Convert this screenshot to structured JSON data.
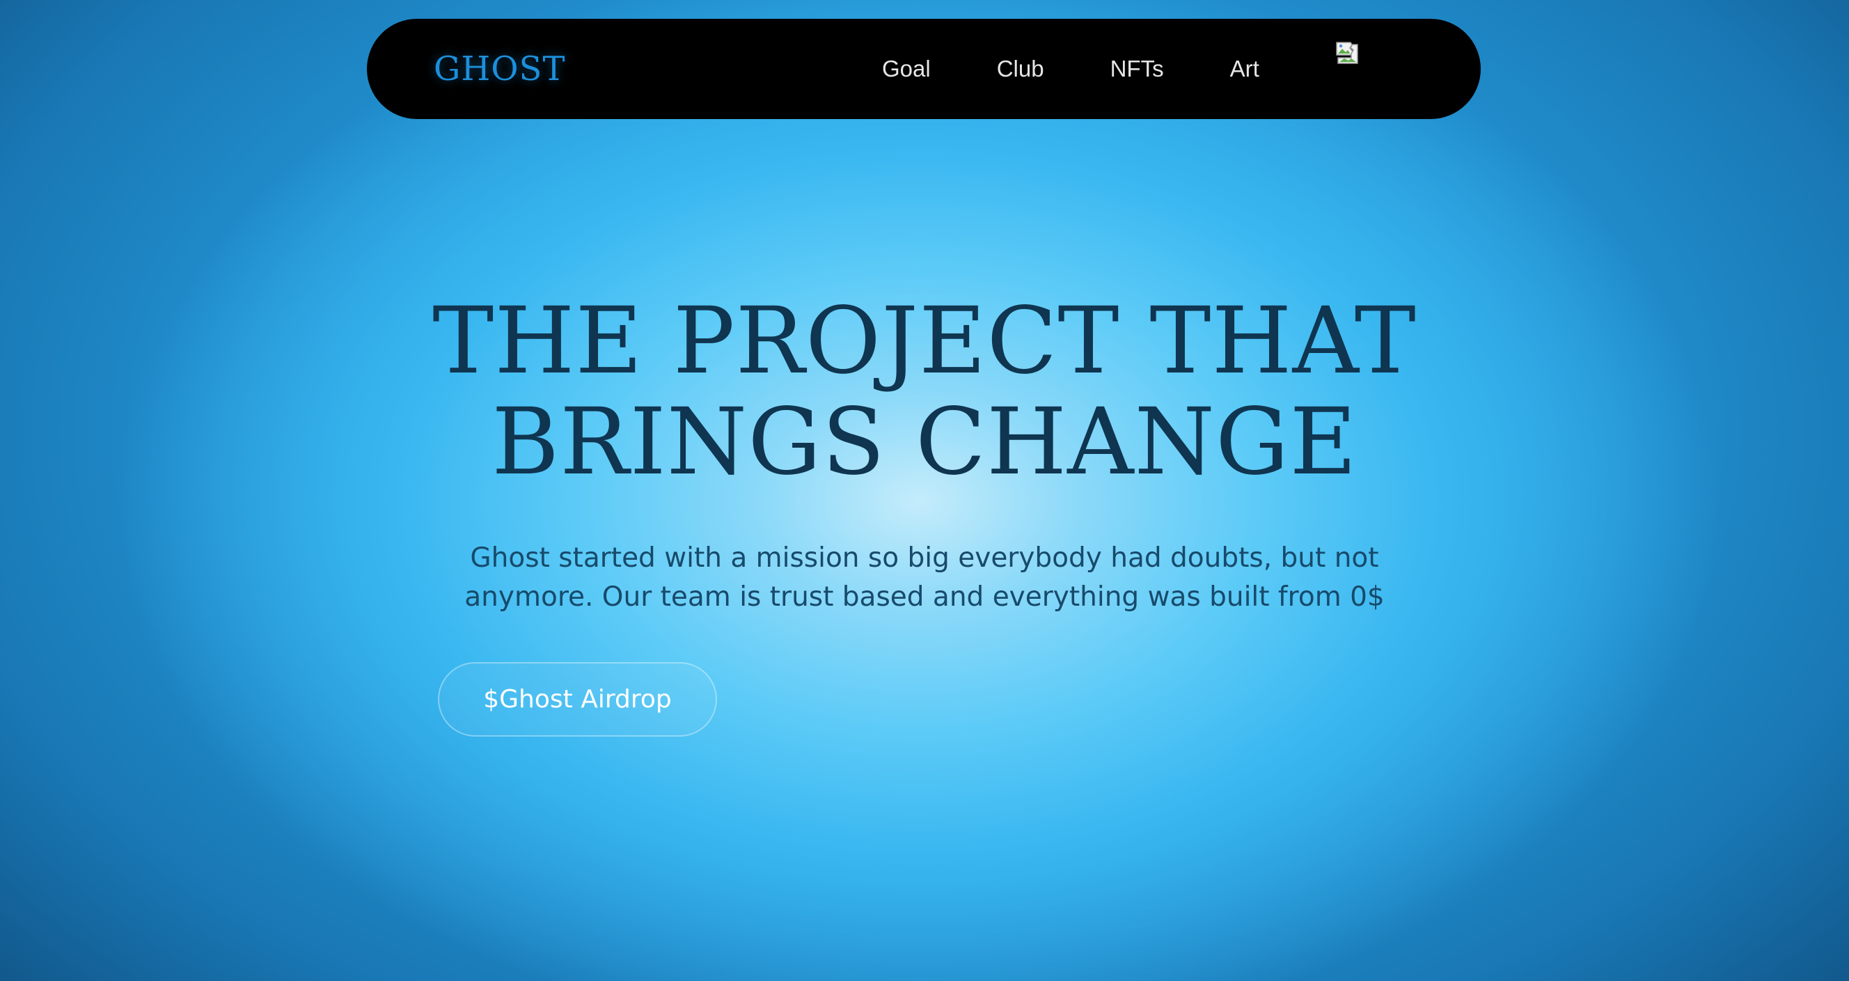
{
  "header": {
    "logo": "GHOST",
    "nav_items": [
      {
        "label": "Goal"
      },
      {
        "label": "Club"
      },
      {
        "label": "NFTs"
      },
      {
        "label": "Art"
      }
    ],
    "profile_image_icon": "broken-image-icon"
  },
  "hero": {
    "title_line1": "THE PROJECT THAT",
    "title_line2": "BRINGS CHANGE",
    "description_line1": "Ghost started with a mission so big everybody had doubts, but not",
    "description_line2": "anymore. Our team is trust based and everything was built from 0$",
    "cta_label": "$Ghost Airdrop"
  },
  "colors": {
    "logo": "#1c8fdb",
    "nav_background": "#000000",
    "title": "#0f3550",
    "description": "#174a6b",
    "background_center": "#c4ecfb",
    "background_edge": "#0f4f80"
  }
}
